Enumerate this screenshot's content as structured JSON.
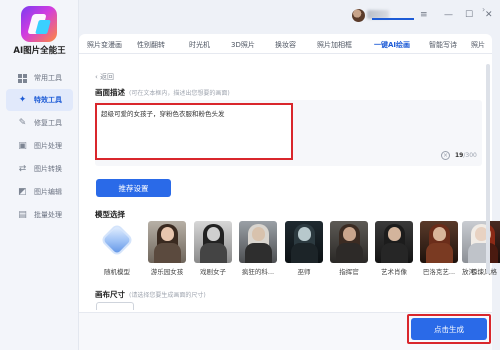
{
  "app": {
    "name": "AI图片全能王"
  },
  "sidebar": {
    "items": [
      {
        "label": "常用工具",
        "icon": "grid-icon"
      },
      {
        "label": "特效工具",
        "icon": "star-icon",
        "active": true
      },
      {
        "label": "修复工具",
        "icon": "wand-icon"
      },
      {
        "label": "图片处理",
        "icon": "image-icon"
      },
      {
        "label": "图片转换",
        "icon": "convert-icon"
      },
      {
        "label": "图片编辑",
        "icon": "edit-icon"
      },
      {
        "label": "批量处理",
        "icon": "batch-icon"
      }
    ]
  },
  "window": {
    "minimize": "—",
    "restore": "☐",
    "close": "✕",
    "menu": "≡"
  },
  "tabs": [
    {
      "label": "照片变漫画"
    },
    {
      "label": "性别翻转"
    },
    {
      "label": "时光机"
    },
    {
      "label": "3D照片"
    },
    {
      "label": "换妆容"
    },
    {
      "label": "照片加相框"
    },
    {
      "label": "一键AI绘画",
      "active": true
    },
    {
      "label": "智能写诗"
    },
    {
      "label": "照片"
    }
  ],
  "tabs_next": "›",
  "back": {
    "arrow": "‹",
    "label": "返回"
  },
  "description": {
    "title": "画面描述",
    "hint": "(可在文本框内，描述出您想要的画面)",
    "value": "超级可爱的女孩子，穿粉色衣服和粉色头发",
    "counter_current": "19",
    "counter_total": "/300",
    "clear_icon": "×"
  },
  "recommend_button": "推荐设置",
  "models": {
    "title": "模型选择",
    "items": [
      {
        "label": "随机模型"
      },
      {
        "label": "游乐园女孩"
      },
      {
        "label": "戏剧女子"
      },
      {
        "label": "疯狂的科..."
      },
      {
        "label": "巫师"
      },
      {
        "label": "指挥官"
      },
      {
        "label": "艺术肖像"
      },
      {
        "label": "巴洛克艺..."
      },
      {
        "label": "惊悚风格"
      },
      {
        "label": "放河..."
      }
    ]
  },
  "canvas": {
    "title": "画布尺寸",
    "hint": "(请选择您要生成画面的尺寸)"
  },
  "generate_button": "点击生成",
  "colors": {
    "accent": "#2a6ae8",
    "highlight": "#d9262c"
  }
}
